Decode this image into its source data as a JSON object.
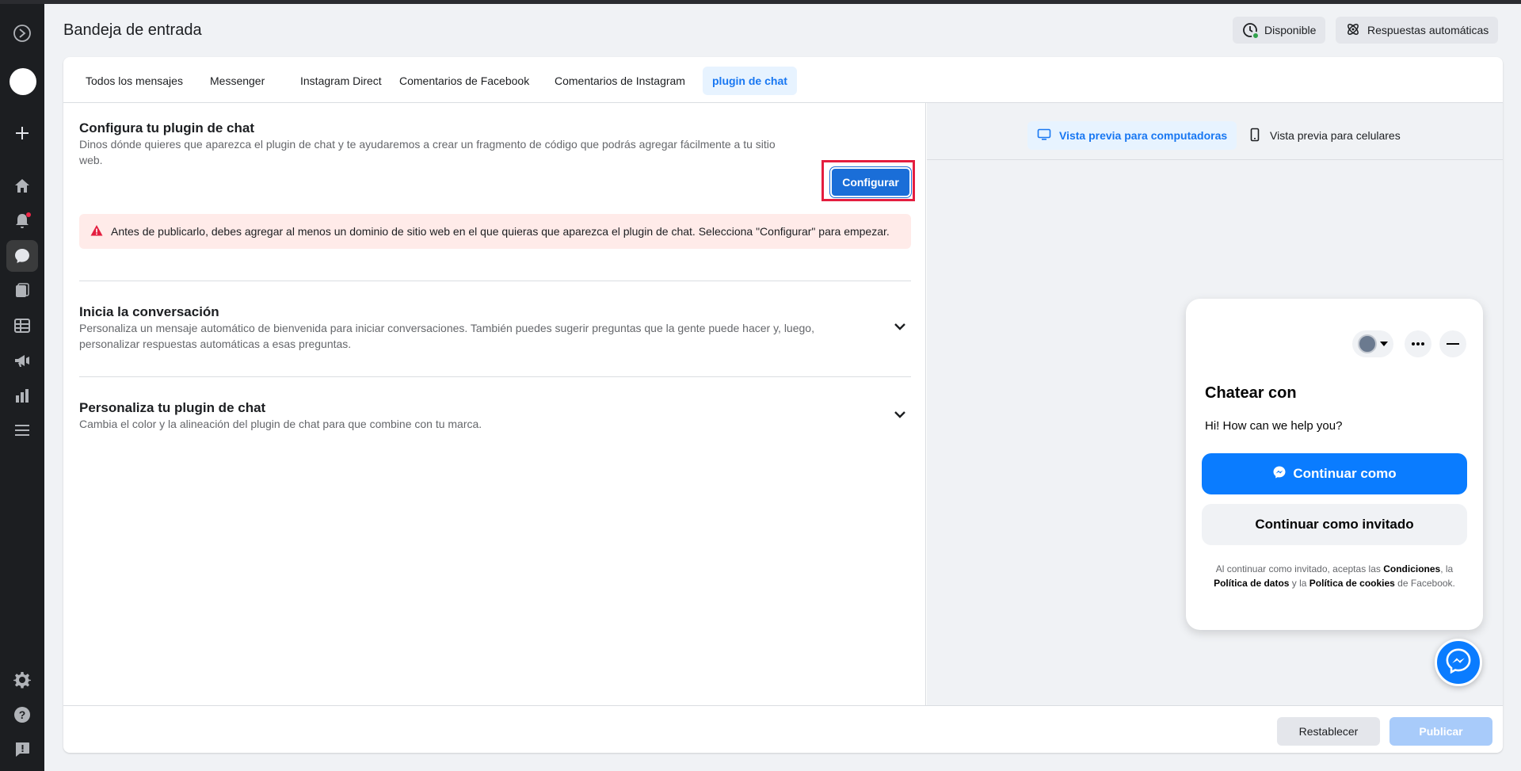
{
  "header": {
    "title": "Bandeja de entrada",
    "status_label": "Disponible",
    "auto_replies_label": "Respuestas automáticas"
  },
  "sidebar": {
    "icons": [
      "meta-logo-icon",
      "avatar",
      "plus-icon",
      "home-icon",
      "bell-icon",
      "chat-icon",
      "pages-icon",
      "table-icon",
      "megaphone-icon",
      "bar-chart-icon",
      "menu-icon",
      "gear-icon",
      "help-icon",
      "report-icon"
    ]
  },
  "tabs": [
    {
      "label": "Todos los mensajes",
      "active": false
    },
    {
      "label": "Messenger",
      "active": false
    },
    {
      "label": "Instagram Direct",
      "active": false
    },
    {
      "label": "Comentarios de Facebook",
      "active": false
    },
    {
      "label": "Comentarios de Instagram",
      "active": false
    },
    {
      "label": "plugin de chat",
      "active": true
    }
  ],
  "config_section": {
    "title": "Configura tu plugin de chat",
    "description": "Dinos dónde quieres que aparezca el plugin de chat y te ayudaremos a crear un fragmento de código que podrás agregar fácilmente a tu sitio web.",
    "button_label": "Configurar",
    "warning": "Antes de publicarlo, debes agregar al menos un dominio de sitio web en el que quieras que aparezca el plugin de chat. Selecciona \"Configurar\" para empezar."
  },
  "conversation_section": {
    "title": "Inicia la conversación",
    "description": "Personaliza un mensaje automático de bienvenida para iniciar conversaciones. También puedes sugerir preguntas que la gente puede hacer y, luego, personalizar respuestas automáticas a esas preguntas."
  },
  "customize_section": {
    "title": "Personaliza tu plugin de chat",
    "description": "Cambia el color y la alineación del plugin de chat para que combine con tu marca."
  },
  "preview": {
    "desktop_label": "Vista previa para computadoras",
    "mobile_label": "Vista previa para celulares",
    "widget": {
      "title": "Chatear con",
      "greeting": "Hi! How can we help you?",
      "continue_as": "Continuar como",
      "continue_guest": "Continuar como invitado",
      "legal_prefix": "Al continuar como invitado, aceptas las ",
      "legal_terms": "Condiciones",
      "legal_sep1": ", la ",
      "legal_data": "Política de datos",
      "legal_sep2": " y la ",
      "legal_cookies": "Política de cookies",
      "legal_suffix": " de Facebook."
    }
  },
  "footer": {
    "reset_label": "Restablecer",
    "publish_label": "Publicar"
  },
  "colors": {
    "accent": "#1877f2",
    "primary_button": "#1a6ed8",
    "messenger_blue": "#0a7cff",
    "warning_bg": "#ffebe9",
    "highlight_outline": "#e41e3f"
  }
}
